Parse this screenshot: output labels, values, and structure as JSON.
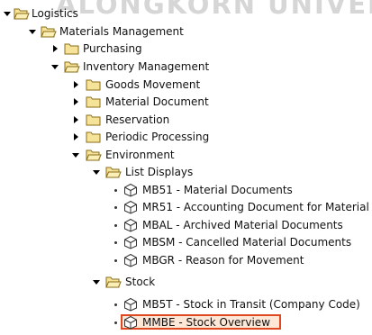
{
  "watermark": "ALONGKORN UNIVERSITY",
  "tree": {
    "logistics": "Logistics",
    "materials_management": "Materials Management",
    "purchasing": "Purchasing",
    "inventory_management": "Inventory Management",
    "goods_movement": "Goods Movement",
    "material_document": "Material Document",
    "reservation": "Reservation",
    "periodic_processing": "Periodic Processing",
    "environment": "Environment",
    "list_displays": "List Displays",
    "mb51": "MB51 - Material Documents",
    "mr51": "MR51 - Accounting Document for Material",
    "mbal": "MBAL - Archived Material Documents",
    "mbsm": "MBSM - Cancelled Material Documents",
    "mbgr": "MBGR - Reason for Movement",
    "stock": "Stock",
    "mb5t": "MB5T - Stock in Transit (Company Code)",
    "mmbe": "MMBE - Stock Overview"
  },
  "colors": {
    "folder_fill": "#f5e39a",
    "folder_stroke": "#8a6d17",
    "selection_border": "#e0491f"
  }
}
